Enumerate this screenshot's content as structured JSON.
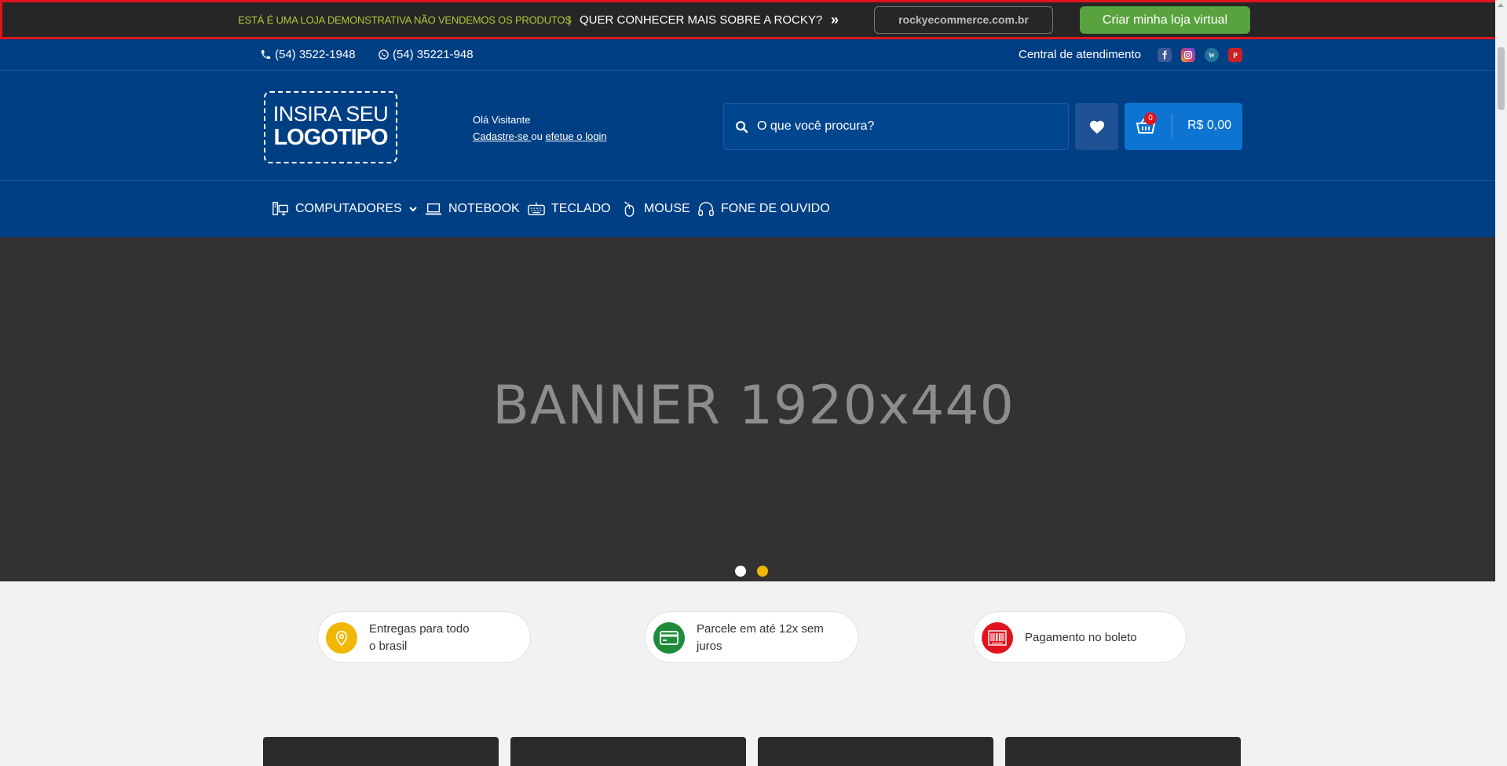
{
  "demo_bar": {
    "notice": "ESTÁ É UMA LOJA DEMONSTRATIVA NÃO VENDEMOS OS PRODUTOS",
    "separator": "|",
    "question": "QUER CONHECER MAIS SOBRE A ROCKY?",
    "arrow": "»",
    "url": "rockyecommerce.com.br",
    "cta": "Criar minha loja virtual",
    "colors": {
      "background": "#262626",
      "border": "#e0141e",
      "notice": "#b5c63a",
      "cta": "#59a33e"
    }
  },
  "topbar": {
    "phone": "(54) 3522-1948",
    "whatsapp": "(54) 35221-948",
    "support": "Central de atendimento",
    "social": [
      {
        "name": "facebook-icon",
        "color": "#3b5998"
      },
      {
        "name": "instagram-icon",
        "color": "#c13584"
      },
      {
        "name": "wordpress-icon",
        "color": "#21759b"
      },
      {
        "name": "pinterest-icon",
        "color": "#cb2027"
      }
    ]
  },
  "header": {
    "logo_line1": "INSIRA SEU",
    "logo_line2": "LOGOTIPO",
    "greeting": "Olá Visitante",
    "register": "Cadastre-se ",
    "or": "ou",
    "login": "efetue o login",
    "search_placeholder": "O que você procura?",
    "cart_count": "0",
    "cart_total": "R$ 0,00",
    "colors": {
      "primary": "#003f84",
      "cart": "#0d74d2",
      "badge": "#e0141e"
    }
  },
  "nav": {
    "items": [
      {
        "label": "COMPUTADORES",
        "icon": "computer-icon",
        "dropdown": true
      },
      {
        "label": "NOTEBOOK",
        "icon": "laptop-icon"
      },
      {
        "label": "TECLADO",
        "icon": "keyboard-icon"
      },
      {
        "label": "MOUSE",
        "icon": "mouse-icon"
      },
      {
        "label": "FONE DE OUVIDO",
        "icon": "headphone-icon"
      }
    ]
  },
  "banner": {
    "text": "BANNER 1920x440",
    "slides": 2,
    "active_slide": 2,
    "colors": {
      "dot_active": "#f2b705",
      "dot_inactive": "#ffffff"
    }
  },
  "features": [
    {
      "text": "Entregas para todo o brasil",
      "line1": "Entregas para todo",
      "line2": "o brasil",
      "icon": "location-pin-icon",
      "color": "#f2b705"
    },
    {
      "text": "Parcele em até 12x sem juros",
      "line1": "Parcele em até 12x sem",
      "line2": "juros",
      "icon": "credit-card-icon",
      "color": "#1e8c3a"
    },
    {
      "text": "Pagamento no boleto",
      "line1": "Pagamento no boleto",
      "line2": "",
      "icon": "barcode-icon",
      "color": "#e0141e"
    }
  ]
}
